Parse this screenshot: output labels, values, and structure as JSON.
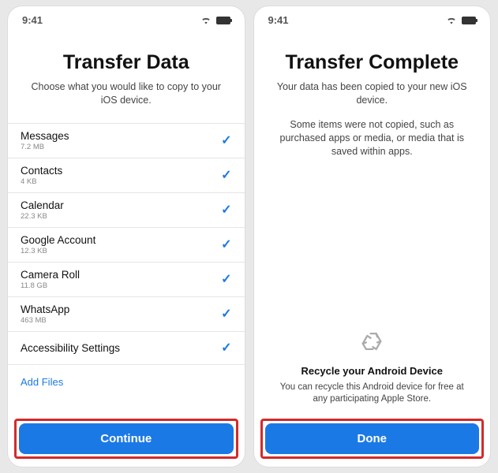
{
  "status": {
    "time": "9:41"
  },
  "left": {
    "title": "Transfer Data",
    "subtitle": "Choose what you would like to copy to your iOS device.",
    "items": [
      {
        "label": "Messages",
        "size": "7.2 MB"
      },
      {
        "label": "Contacts",
        "size": "4 KB"
      },
      {
        "label": "Calendar",
        "size": "22.3 KB"
      },
      {
        "label": "Google Account",
        "size": "12.3 KB"
      },
      {
        "label": "Camera Roll",
        "size": "11.8 GB"
      },
      {
        "label": "WhatsApp",
        "size": "463 MB"
      },
      {
        "label": "Accessibility Settings",
        "size": ""
      }
    ],
    "add_files": "Add Files",
    "button": "Continue"
  },
  "right": {
    "title": "Transfer Complete",
    "subtitle": "Your data has been copied to your new iOS device.",
    "subtitle2": "Some items were not copied, such as purchased apps or media, or media that is saved within apps.",
    "recycle_title": "Recycle your Android Device",
    "recycle_text": "You can recycle this Android device for free at any participating Apple Store.",
    "button": "Done"
  }
}
